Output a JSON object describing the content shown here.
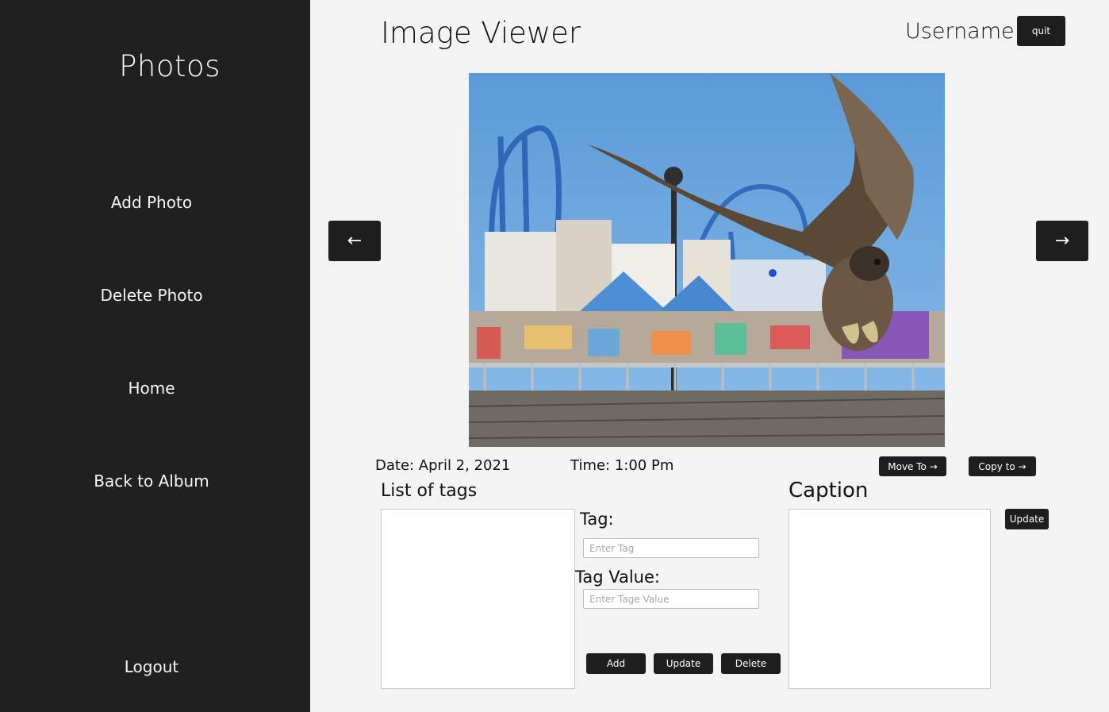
{
  "sidebar": {
    "brand": "Photos",
    "items": [
      {
        "label": "Add Photo"
      },
      {
        "label": "Delete Photo"
      },
      {
        "label": "Home"
      },
      {
        "label": "Back to Album"
      }
    ],
    "logout": "Logout"
  },
  "header": {
    "title": "Image Viewer",
    "username": "Username",
    "quit": "quit"
  },
  "viewer": {
    "prev_icon": "←",
    "next_icon": "→",
    "date": "Date: April 2, 2021",
    "time": "Time: 1:00 Pm",
    "move_to": "Move To →",
    "copy_to": "Copy to →"
  },
  "tags": {
    "list_label": "List of tags",
    "tag_label": "Tag:",
    "tag_placeholder": "Enter Tag",
    "value_label": "Tag Value:",
    "value_placeholder": "Enter Tage Value",
    "add": "Add",
    "update": "Update",
    "delete": "Delete"
  },
  "caption": {
    "label": "Caption",
    "update": "Update"
  },
  "colors": {
    "sidebar_bg": "#202020",
    "button_bg": "#1e1e1e",
    "page_bg": "#f3f3f3"
  }
}
